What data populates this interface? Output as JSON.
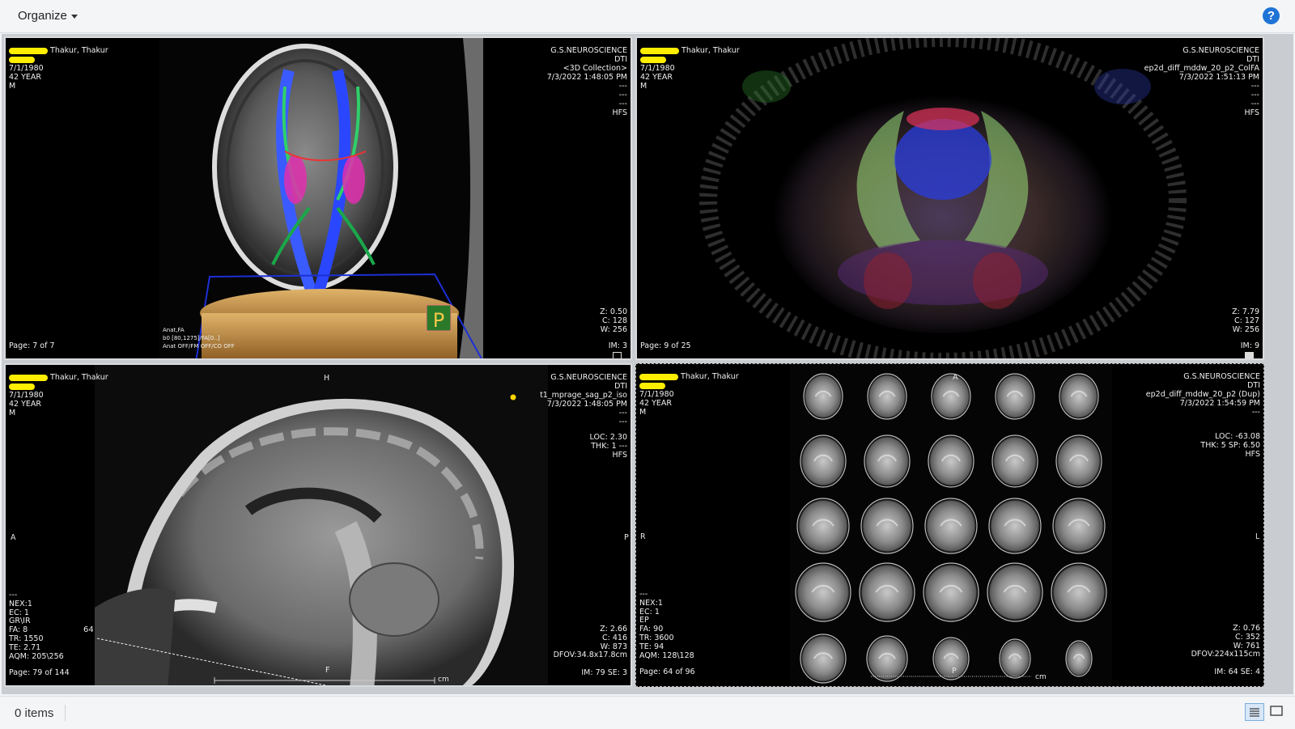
{
  "toolbar": {
    "organize_label": "Organize",
    "help_label": "?"
  },
  "status": {
    "items_label": "0 items"
  },
  "viewports": [
    {
      "patient_name": "Thakur, Thakur",
      "dob": "7/1/1980",
      "age": "42 YEAR",
      "sex": "M",
      "institution": "G.S.NEUROSCIENCE",
      "study": "DTI",
      "series": "<3D Collection>",
      "datetime": "7/3/2022 1:48:05 PM",
      "tr_lines": "---\n---\n---",
      "orientation": "HFS",
      "wl": "Z: 0.50\nC: 128\nW: 256",
      "page": "Page: 7 of 7",
      "im": "IM: 3",
      "tract_label": "Anat,FA\nb0 [80,1275]/FA[0..]\nAnat OFF/FM OFF/CO OFF",
      "orient_badge": "P"
    },
    {
      "patient_name": "Thakur, Thakur",
      "dob": "7/1/1980",
      "age": "42 YEAR",
      "sex": "M",
      "institution": "G.S.NEUROSCIENCE",
      "study": "DTI",
      "series": "ep2d_diff_mddw_20_p2_ColFA",
      "datetime": "7/3/2022 1:51:13 PM",
      "tr_lines": "---\n---\n---",
      "orientation": "HFS",
      "wl": "Z: 7.79\nC: 127\nW: 256",
      "page": "Page: 9 of 25",
      "im": "IM: 9"
    },
    {
      "patient_name": "Thakur, Thakur",
      "dob": "7/1/1980",
      "age": "42 YEAR",
      "sex": "M",
      "institution": "G.S.NEUROSCIENCE",
      "study": "DTI",
      "series": "t1_mprage_sag_p2_iso",
      "datetime": "7/3/2022 1:48:05 PM",
      "tr_lines": "---\n---",
      "loc": "LOC: 2.30\nTHK: 1 ---",
      "orientation": "HFS",
      "wl": "Z: 2.66\nC: 416\nW: 873\nDFOV:34.8x17.8cm",
      "params": "---\nNEX:1\nEC: 1\nGR\\IR\nFA: 8\nTR: 1550\nTE: 2.71\nAQM: 205\\256",
      "page": "Page: 79 of 144",
      "im": "IM: 79 SE: 3",
      "top_marker": "H",
      "left_marker": "A",
      "right_marker": "P",
      "bottom_marker": "F",
      "line_label": "64",
      "ruler_unit": "cm"
    },
    {
      "patient_name": "Thakur, Thakur",
      "dob": "7/1/1980",
      "age": "42 YEAR",
      "sex": "M",
      "institution": "G.S.NEUROSCIENCE",
      "study": "DTI",
      "series": "ep2d_diff_mddw_20_p2 (Dup)",
      "datetime": "7/3/2022 1:54:59 PM",
      "tr_lines": "---",
      "loc": "LOC: -63.08\nTHK: 5 SP: 6.50",
      "orientation": "HFS",
      "wl": "Z: 0.76\nC: 352\nW: 761\nDFOV:224x115cm",
      "params": "---\nNEX:1\nEC: 1\nEP\nFA: 90\nTR: 3600\nTE: 94\nAQM: 128\\128",
      "page": "Page: 64 of 96",
      "im": "IM: 64 SE: 4",
      "top_marker": "A",
      "left_marker": "R",
      "right_marker": "L",
      "bottom_marker": "P",
      "ruler_unit": "cm"
    }
  ]
}
